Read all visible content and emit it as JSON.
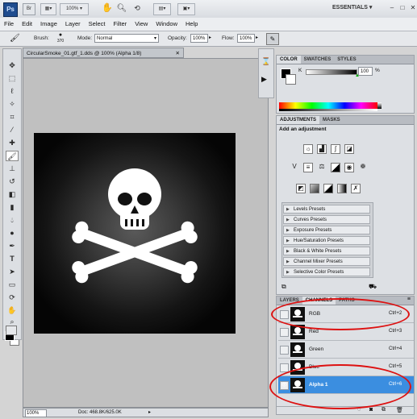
{
  "app": {
    "logo": "Ps",
    "bridge": "Br",
    "zoom": "100%",
    "workspace": "ESSENTIALS"
  },
  "menu": [
    "File",
    "Edit",
    "Image",
    "Layer",
    "Select",
    "Filter",
    "View",
    "Window",
    "Help"
  ],
  "options": {
    "brush_label": "Brush:",
    "brush_size": "370",
    "mode_label": "Mode:",
    "mode_value": "Normal",
    "opacity_label": "Opacity:",
    "opacity_value": "100%",
    "flow_label": "Flow:",
    "flow_value": "100%"
  },
  "document": {
    "tab_title": "CircularSmoke_01.gtf_1.dds @ 100% (Alpha 1/8)",
    "zoom": "100%",
    "doc_info": "Doc: 468.8K/625.0K"
  },
  "color_panel": {
    "tabs": [
      "COLOR",
      "SWATCHES",
      "STYLES"
    ],
    "channel_label": "K",
    "value": "100",
    "unit": "%"
  },
  "adjustments_panel": {
    "tabs": [
      "ADJUSTMENTS",
      "MASKS"
    ],
    "heading": "Add an adjustment",
    "presets": [
      "Levels Presets",
      "Curves Presets",
      "Exposure Presets",
      "Hue/Saturation Presets",
      "Black & White Presets",
      "Channel Mixer Presets",
      "Selective Color Presets"
    ]
  },
  "channels_panel": {
    "tabs": [
      "LAYERS",
      "CHANNELS",
      "PATHS"
    ],
    "rows": [
      {
        "name": "RGB",
        "shortcut": "Ctrl+2",
        "selected": false
      },
      {
        "name": "Red",
        "shortcut": "Ctrl+3",
        "selected": false
      },
      {
        "name": "Green",
        "shortcut": "Ctrl+4",
        "selected": false
      },
      {
        "name": "Blue",
        "shortcut": "Ctrl+5",
        "selected": false
      },
      {
        "name": "Alpha 1",
        "shortcut": "Ctrl+6",
        "selected": true
      }
    ]
  },
  "colors": {
    "selection_blue": "#3b8ee0",
    "annotation_red": "#d11111",
    "canvas_gray": "#c0c0c0"
  }
}
